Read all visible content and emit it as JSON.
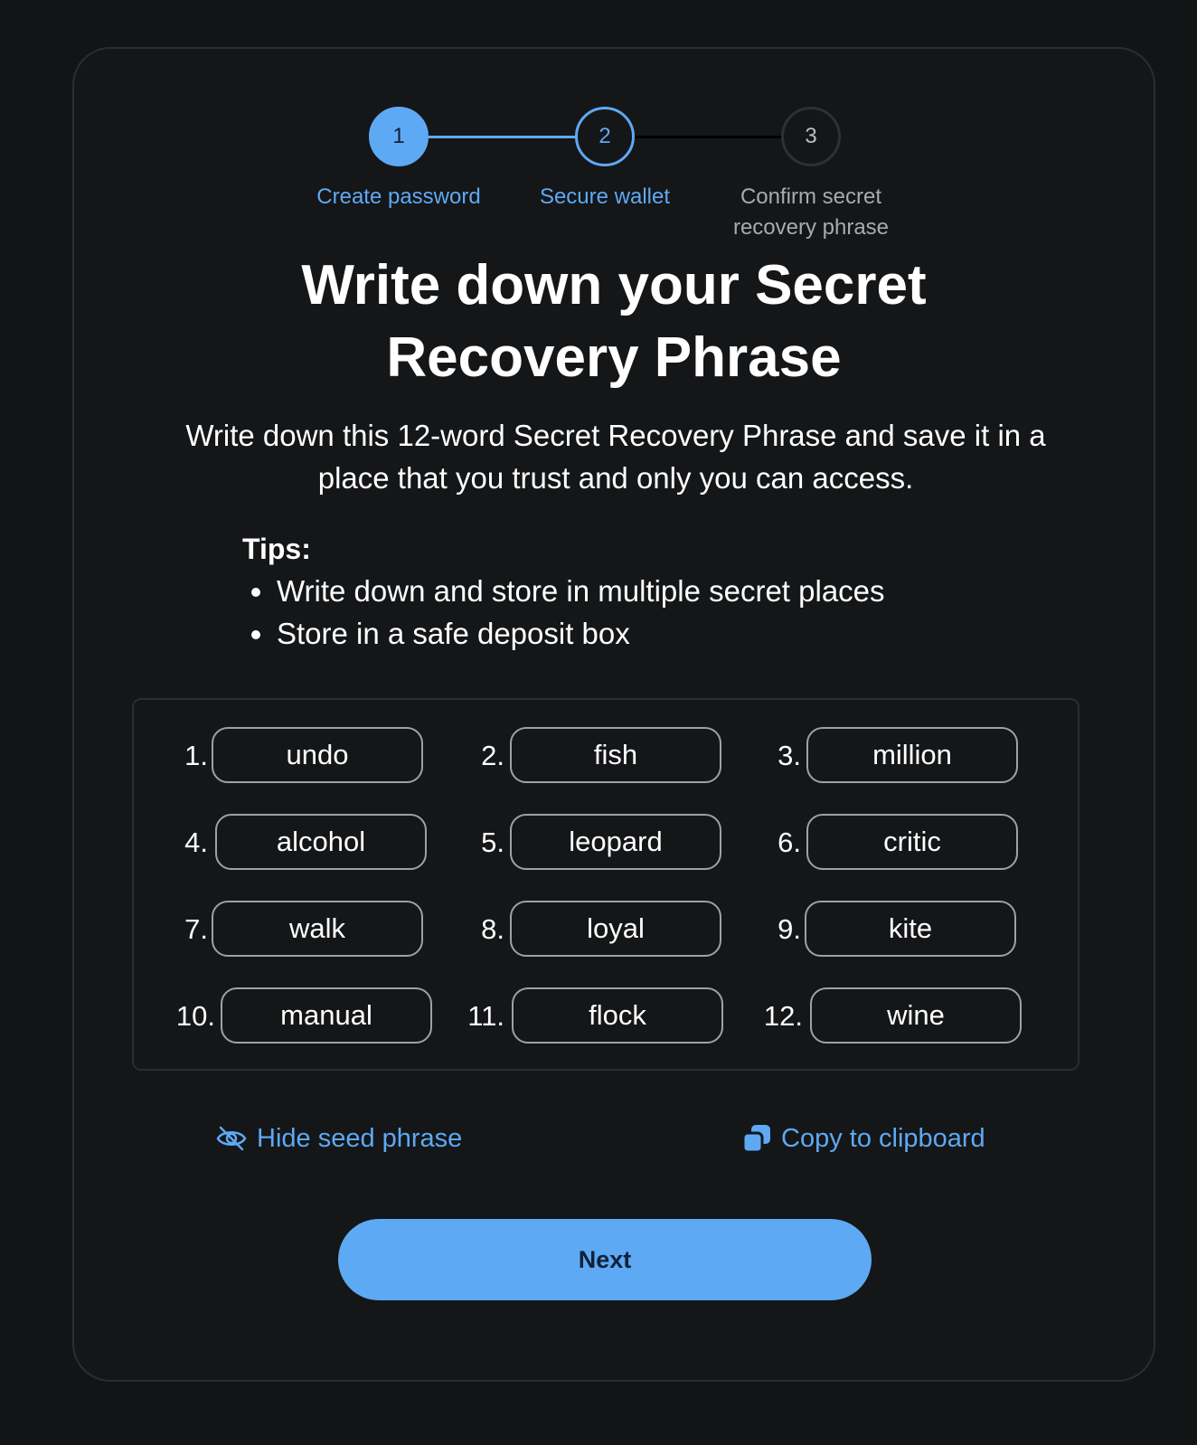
{
  "stepper": {
    "steps": [
      {
        "number": "1",
        "label": "Create password",
        "state": "done"
      },
      {
        "number": "2",
        "label": "Secure wallet",
        "state": "active"
      },
      {
        "number": "3",
        "label_line1": "Confirm secret",
        "label_line2": "recovery phrase",
        "state": "todo"
      }
    ]
  },
  "page": {
    "title_line1": "Write down your Secret",
    "title_line2": "Recovery Phrase",
    "description_line1": "Write down this 12-word Secret Recovery Phrase and save it in a",
    "description_line2": "place that you trust and only you can access.",
    "tips_title": "Tips:",
    "tips": [
      "Write down and store in multiple secret places",
      "Store in a safe deposit box"
    ]
  },
  "phrase": {
    "words": [
      {
        "num": "1.",
        "word": "undo"
      },
      {
        "num": "2.",
        "word": "fish"
      },
      {
        "num": "3.",
        "word": "million"
      },
      {
        "num": "4.",
        "word": "alcohol"
      },
      {
        "num": "5.",
        "word": "leopard"
      },
      {
        "num": "6.",
        "word": "critic"
      },
      {
        "num": "7.",
        "word": "walk"
      },
      {
        "num": "8.",
        "word": "loyal"
      },
      {
        "num": "9.",
        "word": "kite"
      },
      {
        "num": "10.",
        "word": "manual"
      },
      {
        "num": "11.",
        "word": "flock"
      },
      {
        "num": "12.",
        "word": "wine"
      }
    ]
  },
  "actions": {
    "hide_label": "Hide seed phrase",
    "hide_icon": "eye-slash-icon",
    "copy_label": "Copy to clipboard",
    "copy_icon": "copy-icon",
    "next_label": "Next"
  },
  "colors": {
    "accent": "#5ea9f3",
    "background": "#131416",
    "card_border": "#2b2d31"
  }
}
